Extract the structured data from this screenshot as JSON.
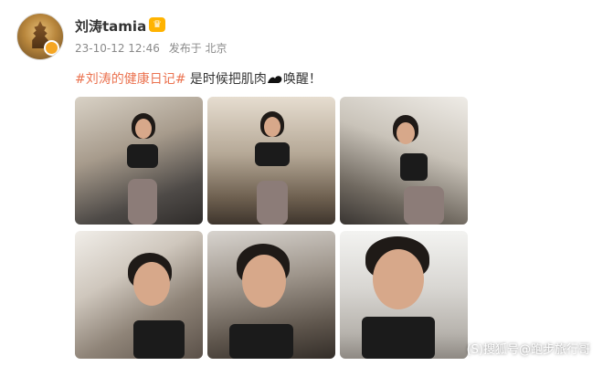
{
  "post": {
    "username": "刘涛tamia",
    "verified_badge_icon": "crown-icon",
    "time": "23-10-12 12:46",
    "location": "发布于 北京",
    "hashtag": "#刘涛的健康日记#",
    "text_before_icon": " 是时候把肌肉",
    "text_after_icon": "唤醒！",
    "inline_icon": "flexed-biceps-icon"
  },
  "photos": [
    {
      "label": "photo-1"
    },
    {
      "label": "photo-2"
    },
    {
      "label": "photo-3"
    },
    {
      "label": "photo-4"
    },
    {
      "label": "photo-5"
    },
    {
      "label": "photo-6"
    }
  ],
  "watermark": "(S)搜狐号@跑步旅行哥",
  "colors": {
    "hashtag": "#eb7350",
    "username": "#333333",
    "meta": "#8a8a8a"
  }
}
